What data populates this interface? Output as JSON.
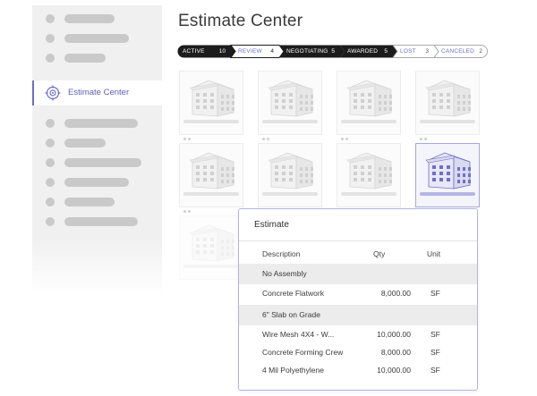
{
  "sidebar": {
    "active_label": "Estimate Center"
  },
  "page_title": "Estimate Center",
  "pipeline": [
    {
      "label": "ACTIVE",
      "count": "10"
    },
    {
      "label": "REVIEW",
      "count": "4"
    },
    {
      "label": "NEGOTIATING",
      "count": "5"
    },
    {
      "label": "AWARDED",
      "count": "5"
    },
    {
      "label": "LOST",
      "count": "3"
    },
    {
      "label": "CANCELED",
      "count": "2"
    }
  ],
  "estimate": {
    "title": "Estimate",
    "columns": {
      "description": "Description",
      "qty": "Qty",
      "unit": "Unit"
    },
    "group1": "No Assembly",
    "row1": {
      "description": "Concrete Flatwork",
      "qty": "8,000.00",
      "unit": "SF"
    },
    "group2": "6\" Slab on Grade",
    "row2": {
      "description": "Wire Mesh 4X4 - W...",
      "qty": "10,000.00",
      "unit": "SF"
    },
    "row3": {
      "description": "Concrete Forming Crew",
      "qty": "8,000.00",
      "unit": "SF"
    },
    "row4": {
      "description": "4 Mil Polyethylene",
      "qty": "10,000.00",
      "unit": "SF"
    }
  },
  "colors": {
    "accent": "#6e6ec8",
    "pipeline_dark": "#1c1c1c",
    "pipeline_light_text": "#6e6ec8",
    "sidebar_bg": "#f0f0f0",
    "placeholder": "#c9c9c9"
  },
  "icons": {
    "sidebar_active": "target-icon",
    "tile": "building-icon"
  }
}
